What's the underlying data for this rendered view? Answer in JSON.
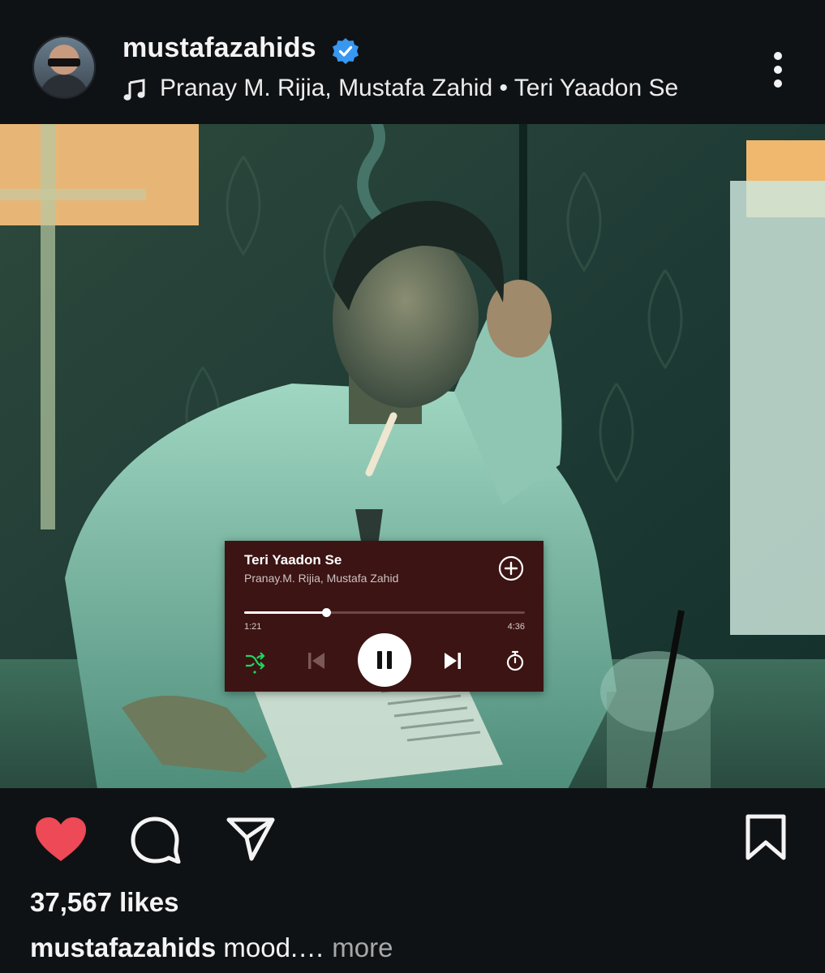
{
  "post": {
    "username": "mustafazahids",
    "verified": true,
    "music_artists": "Pranay M. Rijia, Mustafa Zahid",
    "music_separator": " • ",
    "music_title": "Teri Yaadon Se",
    "icons": {
      "avatar": "avatar",
      "verified": "verified-badge-icon",
      "music": "music-note-icon",
      "more": "more-options-icon"
    }
  },
  "player": {
    "song": "Teri Yaadon Se",
    "artists": "Pranay.M. Rijia, Mustafa Zahid",
    "elapsed": "1:21",
    "total": "4:36",
    "progress_fraction": 0.293,
    "shuffle_active": true,
    "state": "playing",
    "colors": {
      "background": "#3b1413",
      "accent": "#1ed760"
    },
    "icons": [
      "add-icon",
      "shuffle-icon",
      "previous-icon",
      "pause-icon",
      "next-icon",
      "sleep-timer-icon"
    ]
  },
  "media": {
    "sound_icon": "volume-on-icon"
  },
  "actions": {
    "liked": true,
    "like_color": "#ed4956",
    "icons": [
      "heart-icon",
      "comment-icon",
      "share-icon",
      "bookmark-icon"
    ]
  },
  "stats": {
    "likes": "37,567 likes"
  },
  "caption": {
    "user": "mustafazahids",
    "text": " mood.…",
    "more": " more"
  }
}
